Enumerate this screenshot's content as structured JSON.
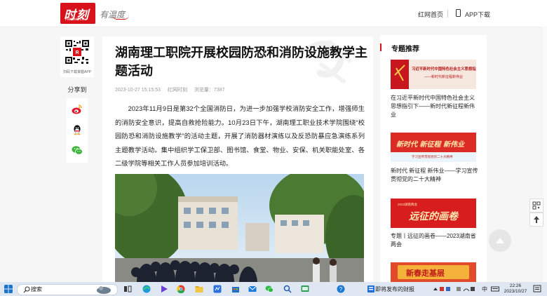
{
  "header": {
    "logo_text": "时刻",
    "logo_sub": "Rednet.cn",
    "slogan": "有温度",
    "nav_home": "红网首页",
    "nav_app": "APP下载"
  },
  "left": {
    "qr_caption": "扫码下载掌握APP",
    "share_label": "分享到",
    "share_icons": [
      "weibo-icon",
      "qq-icon",
      "wechat-icon"
    ]
  },
  "article": {
    "title": "湖南理工职院开展校园防恐和消防设施教学主题活动",
    "date": "2023-10-27 15:15:53",
    "source": "红网时刻",
    "views": "浏览量：7387",
    "paragraph": "2023年11月9日是第32个全国消防日，为进一步加强学校消防安全工作，增强师生的消防安全意识，提高自救抢险能力。10月23日下午，湖南理工职业技术学院围绕“校园防恐和消防设施教学”的活动主题，开展了消防器材演练以及反恐防暴应急演练系列主题教学活动。集中组织学工保卫部、图书馆、食堂、物业、安保、机关职能处室、各二级学院等相关工作人员参加培训活动。"
  },
  "sidebar": {
    "title": "专题推荐",
    "items": [
      {
        "banner": "习近平新时代中国特色社会主义思想指引下——新时代新征程新伟业",
        "caption": "在习近平新时代中国特色社会主义思想指引下——新时代新征程新伟业"
      },
      {
        "banner": "新时代 新征程 新伟业",
        "caption": "新时代 新征程 新伟业——学习宣传贯彻党的二十大精神"
      },
      {
        "banner": "远征的画卷",
        "caption": "专题丨远征的画卷——2023湖南省两会"
      },
      {
        "banner": "新春走基层",
        "caption": ""
      }
    ]
  },
  "taskbar": {
    "search": "搜索",
    "weather": "即将发布的财报",
    "ime": "中",
    "time": "22:26",
    "date": "2023/10/27"
  },
  "colors": {
    "brand": "#d8121a"
  }
}
